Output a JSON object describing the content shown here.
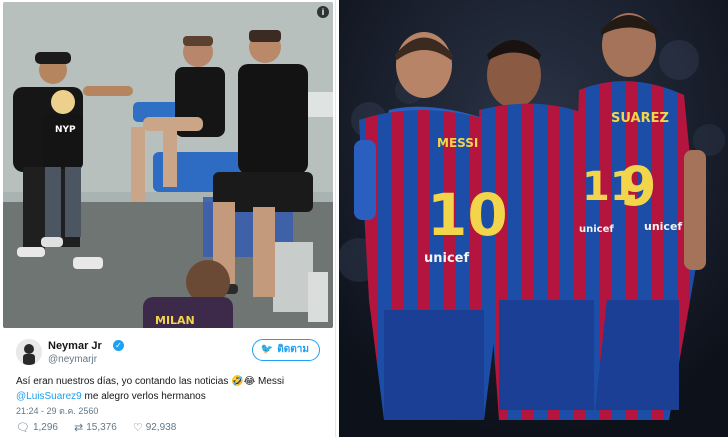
{
  "tweet": {
    "display_name": "Neymar Jr",
    "handle": "@neymarjr",
    "follow_label": "ติดตาม",
    "text_line1": "Así eran nuestros días, yo contando las noticias 🤣😂 Messi",
    "mention": "@LuisSuarez9",
    "text_line2_rest": " me alegro verlos hermanos",
    "timestamp": "21:24 - 29 ต.ค. 2560",
    "replies": "1,296",
    "retweets": "15,376",
    "likes": "92,938",
    "photo_shirt_text": "MILAN",
    "photo_shirt_text2": "NYP"
  },
  "photo": {
    "player_left": {
      "name": "MESSI",
      "number": "10",
      "sponsor": "unicef"
    },
    "player_center": {
      "number": "11",
      "sponsor": "unicef"
    },
    "player_right": {
      "name": "SUAREZ",
      "number": "9",
      "sponsor": "unicef"
    }
  },
  "colors": {
    "twitter_blue": "#1da1f2",
    "barca_blue": "#1c4ea7",
    "barca_red": "#b3153e",
    "number_yellow": "#f2d54a"
  },
  "icons": [
    "info-icon",
    "verified-icon",
    "twitter-bird-icon",
    "reply-icon",
    "retweet-icon",
    "like-icon"
  ]
}
